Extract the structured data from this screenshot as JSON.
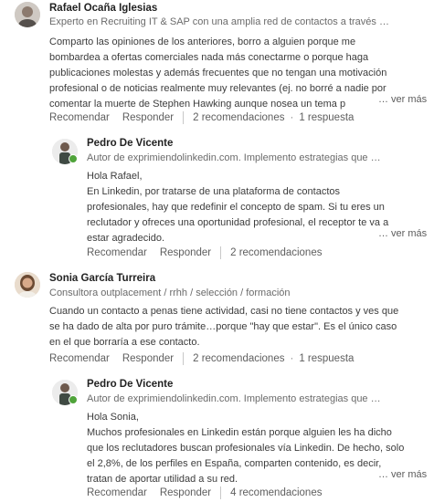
{
  "comments": [
    {
      "name": "Rafael Ocaña Iglesias",
      "headline": "Experto en Recruiting IT & SAP con una amplia red de contactos a través …",
      "lines": [
        "Comparto las opiniones de los anteriores, borro a alguien porque me",
        "bombardea a ofertas comerciales nada más conectarme o porque haga",
        "publicaciones molestas y además frecuentes que no tengan una motivación",
        "profesional o de noticias realmente muy relevantes (ej. no borré a nadie por",
        "comentar la muerte de Stephen Hawking aunque nosea un tema p"
      ],
      "more": "… ver más",
      "recommend": "Recomendar",
      "reply": "Responder",
      "recommendations": "2 recomendaciones",
      "replies": "1 respuesta"
    },
    {
      "name": "Pedro De Vicente",
      "headline": "Autor de exprimiendolinkedin.com. Implemento estrategias que …",
      "lines": [
        "Hola Rafael,",
        "En Linkedin, por tratarse de una plataforma de contactos",
        "profesionales, hay que redefinir el concepto de spam. Si tu eres un",
        "reclutador y ofreces una oportunidad profesional, el receptor te va a",
        "estar agradecido."
      ],
      "more": "… ver más",
      "recommend": "Recomendar",
      "reply": "Responder",
      "recommendations": "2 recomendaciones"
    },
    {
      "name": "Sonia García Turreira",
      "headline": "Consultora outplacement / rrhh / selección / formación",
      "lines": [
        "Cuando un contacto a penas tiene actividad, casi no tiene contactos y ves que",
        "se ha dado de alta por puro trámite…porque \"hay que estar\". Es el único caso",
        "en el que borraría a ese contacto."
      ],
      "recommend": "Recomendar",
      "reply": "Responder",
      "recommendations": "2 recomendaciones",
      "replies": "1 respuesta"
    },
    {
      "name": "Pedro De Vicente",
      "headline": "Autor de exprimiendolinkedin.com. Implemento estrategias que …",
      "lines": [
        "Hola Sonia,",
        "Muchos profesionales en Linkedin están porque alguien les ha dicho",
        "que los reclutadores buscan profesionales vía Linkedin. De hecho, solo",
        "el 2,8%, de los perfiles en España, comparten contenido, es decir,",
        "tratan de aportar utilidad a su red."
      ],
      "more": "… ver más",
      "recommend": "Recomendar",
      "reply": "Responder",
      "recommendations": "4 recomendaciones"
    }
  ],
  "bullet": "·",
  "colors": {
    "online": "#4fa33a",
    "text": "#3c3c3c",
    "muted": "#6b6b6b"
  }
}
